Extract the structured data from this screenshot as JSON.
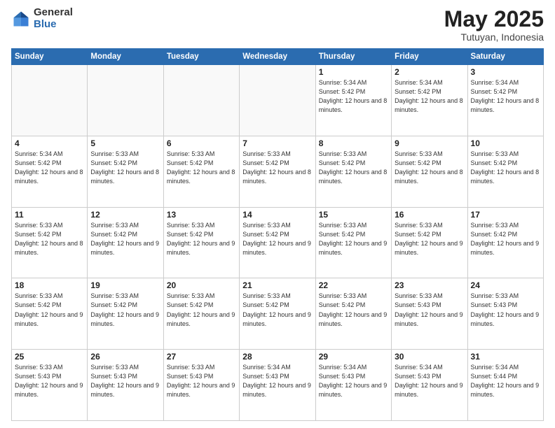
{
  "header": {
    "logo_general": "General",
    "logo_blue": "Blue",
    "month_title": "May 2025",
    "location": "Tutuyan, Indonesia"
  },
  "weekdays": [
    "Sunday",
    "Monday",
    "Tuesday",
    "Wednesday",
    "Thursday",
    "Friday",
    "Saturday"
  ],
  "weeks": [
    [
      {
        "day": "",
        "info": ""
      },
      {
        "day": "",
        "info": ""
      },
      {
        "day": "",
        "info": ""
      },
      {
        "day": "",
        "info": ""
      },
      {
        "day": "1",
        "info": "Sunrise: 5:34 AM\nSunset: 5:42 PM\nDaylight: 12 hours\nand 8 minutes."
      },
      {
        "day": "2",
        "info": "Sunrise: 5:34 AM\nSunset: 5:42 PM\nDaylight: 12 hours\nand 8 minutes."
      },
      {
        "day": "3",
        "info": "Sunrise: 5:34 AM\nSunset: 5:42 PM\nDaylight: 12 hours\nand 8 minutes."
      }
    ],
    [
      {
        "day": "4",
        "info": "Sunrise: 5:34 AM\nSunset: 5:42 PM\nDaylight: 12 hours\nand 8 minutes."
      },
      {
        "day": "5",
        "info": "Sunrise: 5:33 AM\nSunset: 5:42 PM\nDaylight: 12 hours\nand 8 minutes."
      },
      {
        "day": "6",
        "info": "Sunrise: 5:33 AM\nSunset: 5:42 PM\nDaylight: 12 hours\nand 8 minutes."
      },
      {
        "day": "7",
        "info": "Sunrise: 5:33 AM\nSunset: 5:42 PM\nDaylight: 12 hours\nand 8 minutes."
      },
      {
        "day": "8",
        "info": "Sunrise: 5:33 AM\nSunset: 5:42 PM\nDaylight: 12 hours\nand 8 minutes."
      },
      {
        "day": "9",
        "info": "Sunrise: 5:33 AM\nSunset: 5:42 PM\nDaylight: 12 hours\nand 8 minutes."
      },
      {
        "day": "10",
        "info": "Sunrise: 5:33 AM\nSunset: 5:42 PM\nDaylight: 12 hours\nand 8 minutes."
      }
    ],
    [
      {
        "day": "11",
        "info": "Sunrise: 5:33 AM\nSunset: 5:42 PM\nDaylight: 12 hours\nand 8 minutes."
      },
      {
        "day": "12",
        "info": "Sunrise: 5:33 AM\nSunset: 5:42 PM\nDaylight: 12 hours\nand 9 minutes."
      },
      {
        "day": "13",
        "info": "Sunrise: 5:33 AM\nSunset: 5:42 PM\nDaylight: 12 hours\nand 9 minutes."
      },
      {
        "day": "14",
        "info": "Sunrise: 5:33 AM\nSunset: 5:42 PM\nDaylight: 12 hours\nand 9 minutes."
      },
      {
        "day": "15",
        "info": "Sunrise: 5:33 AM\nSunset: 5:42 PM\nDaylight: 12 hours\nand 9 minutes."
      },
      {
        "day": "16",
        "info": "Sunrise: 5:33 AM\nSunset: 5:42 PM\nDaylight: 12 hours\nand 9 minutes."
      },
      {
        "day": "17",
        "info": "Sunrise: 5:33 AM\nSunset: 5:42 PM\nDaylight: 12 hours\nand 9 minutes."
      }
    ],
    [
      {
        "day": "18",
        "info": "Sunrise: 5:33 AM\nSunset: 5:42 PM\nDaylight: 12 hours\nand 9 minutes."
      },
      {
        "day": "19",
        "info": "Sunrise: 5:33 AM\nSunset: 5:42 PM\nDaylight: 12 hours\nand 9 minutes."
      },
      {
        "day": "20",
        "info": "Sunrise: 5:33 AM\nSunset: 5:42 PM\nDaylight: 12 hours\nand 9 minutes."
      },
      {
        "day": "21",
        "info": "Sunrise: 5:33 AM\nSunset: 5:42 PM\nDaylight: 12 hours\nand 9 minutes."
      },
      {
        "day": "22",
        "info": "Sunrise: 5:33 AM\nSunset: 5:42 PM\nDaylight: 12 hours\nand 9 minutes."
      },
      {
        "day": "23",
        "info": "Sunrise: 5:33 AM\nSunset: 5:43 PM\nDaylight: 12 hours\nand 9 minutes."
      },
      {
        "day": "24",
        "info": "Sunrise: 5:33 AM\nSunset: 5:43 PM\nDaylight: 12 hours\nand 9 minutes."
      }
    ],
    [
      {
        "day": "25",
        "info": "Sunrise: 5:33 AM\nSunset: 5:43 PM\nDaylight: 12 hours\nand 9 minutes."
      },
      {
        "day": "26",
        "info": "Sunrise: 5:33 AM\nSunset: 5:43 PM\nDaylight: 12 hours\nand 9 minutes."
      },
      {
        "day": "27",
        "info": "Sunrise: 5:33 AM\nSunset: 5:43 PM\nDaylight: 12 hours\nand 9 minutes."
      },
      {
        "day": "28",
        "info": "Sunrise: 5:34 AM\nSunset: 5:43 PM\nDaylight: 12 hours\nand 9 minutes."
      },
      {
        "day": "29",
        "info": "Sunrise: 5:34 AM\nSunset: 5:43 PM\nDaylight: 12 hours\nand 9 minutes."
      },
      {
        "day": "30",
        "info": "Sunrise: 5:34 AM\nSunset: 5:43 PM\nDaylight: 12 hours\nand 9 minutes."
      },
      {
        "day": "31",
        "info": "Sunrise: 5:34 AM\nSunset: 5:44 PM\nDaylight: 12 hours\nand 9 minutes."
      }
    ]
  ]
}
